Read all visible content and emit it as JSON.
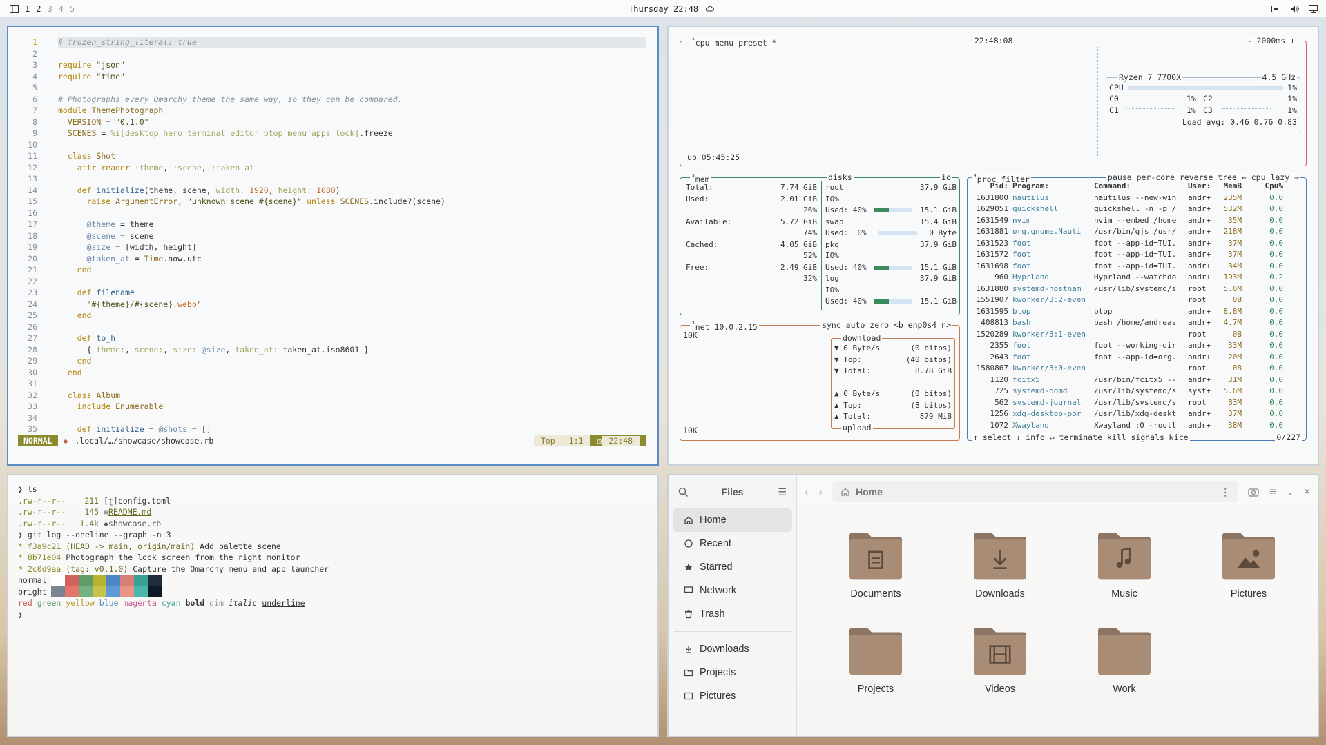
{
  "topbar": {
    "workspaces": [
      "1",
      "2",
      "3",
      "4",
      "5"
    ],
    "clock": "Thursday 22:48"
  },
  "editor": {
    "lines": [
      {
        "n": "1",
        "html": "<span class=\"c\"># frozen_string_literal: true</span>"
      },
      {
        "n": "2",
        "html": ""
      },
      {
        "n": "3",
        "html": "<span class=\"k\">require</span> <span class=\"s\">\"json\"</span>"
      },
      {
        "n": "4",
        "html": "<span class=\"k\">require</span> <span class=\"s\">\"time\"</span>"
      },
      {
        "n": "5",
        "html": ""
      },
      {
        "n": "6",
        "html": "<span class=\"c\"># Photographs every Omarchy theme the same way, so they can be compared.</span>"
      },
      {
        "n": "7",
        "html": "<span class=\"k\">module</span> <span class=\"cn\">ThemePhotograph</span>"
      },
      {
        "n": "8",
        "html": "  <span class=\"cn\">VERSION</span> = <span class=\"s\">\"0.1.0\"</span>"
      },
      {
        "n": "9",
        "html": "  <span class=\"cn\">SCENES</span> = <span class=\"sym\">%i[desktop hero terminal editor btop menu apps lock]</span>.freeze"
      },
      {
        "n": "10",
        "html": ""
      },
      {
        "n": "11",
        "html": "  <span class=\"k\">class</span> <span class=\"cn\">Shot</span>"
      },
      {
        "n": "12",
        "html": "    <span class=\"k\">attr_reader</span> <span class=\"sym\">:theme</span>, <span class=\"sym\">:scene</span>, <span class=\"sym\">:taken_at</span>"
      },
      {
        "n": "13",
        "html": ""
      },
      {
        "n": "14",
        "html": "    <span class=\"k\">def</span> <span class=\"fn\">initialize</span>(theme, scene, <span class=\"sym\">width:</span> <span class=\"nm\">1920</span>, <span class=\"sym\">height:</span> <span class=\"nm\">1080</span>)"
      },
      {
        "n": "15",
        "html": "      <span class=\"k\">raise</span> <span class=\"cn\">ArgumentError</span>, <span class=\"s\">\"unknown scene #{scene}\"</span> <span class=\"k\">unless</span> <span class=\"cn\">SCENES</span>.include?(scene)"
      },
      {
        "n": "16",
        "html": ""
      },
      {
        "n": "17",
        "html": "      <span class=\"iv\">@theme</span> = theme"
      },
      {
        "n": "18",
        "html": "      <span class=\"iv\">@scene</span> = scene"
      },
      {
        "n": "19",
        "html": "      <span class=\"iv\">@size</span> = [width, height]"
      },
      {
        "n": "20",
        "html": "      <span class=\"iv\">@taken_at</span> = <span class=\"cn\">Time</span>.now.utc"
      },
      {
        "n": "21",
        "html": "    <span class=\"k\">end</span>"
      },
      {
        "n": "22",
        "html": ""
      },
      {
        "n": "23",
        "html": "    <span class=\"k\">def</span> <span class=\"fn\">filename</span>"
      },
      {
        "n": "24",
        "html": "      <span class=\"s\">\"#{theme}/#{scene}<span class=\"nm\">.webp</span>\"</span>"
      },
      {
        "n": "25",
        "html": "    <span class=\"k\">end</span>"
      },
      {
        "n": "26",
        "html": ""
      },
      {
        "n": "27",
        "html": "    <span class=\"k\">def</span> <span class=\"fn\">to_h</span>"
      },
      {
        "n": "28",
        "html": "      { <span class=\"sym\">theme:</span>, <span class=\"sym\">scene:</span>, <span class=\"sym\">size:</span> <span class=\"iv\">@size</span>, <span class=\"sym\">taken_at:</span> taken_at.iso8601 }"
      },
      {
        "n": "29",
        "html": "    <span class=\"k\">end</span>"
      },
      {
        "n": "30",
        "html": "  <span class=\"k\">end</span>"
      },
      {
        "n": "31",
        "html": ""
      },
      {
        "n": "32",
        "html": "  <span class=\"k\">class</span> <span class=\"cn\">Album</span>"
      },
      {
        "n": "33",
        "html": "    <span class=\"k\">include</span> <span class=\"cn\">Enumerable</span>"
      },
      {
        "n": "34",
        "html": ""
      },
      {
        "n": "35",
        "html": "    <span class=\"k\">def</span> <span class=\"fn\">initialize</span> = <span class=\"iv\">@shots</span> = []"
      }
    ],
    "mode": "NORMAL",
    "path": ".local/…/showcase/showcase.rb",
    "pos_top": "Top",
    "pos_line": "1:1",
    "pos_time": "22:48"
  },
  "btop": {
    "cpu_tab": "cpu",
    "menu_tab": "menu",
    "preset_tab": "preset *",
    "clock": "22:48:08",
    "interval": "- 2000ms +",
    "cpu_model": "Ryzen 7 7700X",
    "cpu_freq": "4.5 GHz",
    "cpu_total_label": "CPU",
    "cpu_total_pct": "1%",
    "cores": [
      {
        "a": "C0",
        "ap": "1%",
        "b": "C2",
        "bp": "1%"
      },
      {
        "a": "C1",
        "ap": "1%",
        "b": "C3",
        "bp": "1%"
      }
    ],
    "load_avg": "Load avg: 0.46 0.76 0.83",
    "uptime": "up 05:45:25",
    "mem_title": "mem",
    "disks_title": "disks",
    "io_title": "io",
    "mem_rows": [
      {
        "l": "Total:",
        "v": "7.74 GiB"
      },
      {
        "l": "Used:",
        "v": "2.01 GiB"
      },
      {
        "l": "",
        "v": "26%"
      },
      {
        "l": "Available:",
        "v": "5.72 GiB"
      },
      {
        "l": "",
        "v": "74%"
      },
      {
        "l": "Cached:",
        "v": "4.05 GiB"
      },
      {
        "l": "",
        "v": "52%"
      },
      {
        "l": "Free:",
        "v": "2.49 GiB"
      },
      {
        "l": "",
        "v": "32%"
      }
    ],
    "disk_rows": [
      {
        "l": "root",
        "v": "37.9 GiB"
      },
      {
        "l": "IO%",
        "v": ""
      },
      {
        "l": "Used: 40%",
        "v": "15.1 GiB",
        "bar": 0.4
      },
      {
        "l": "swap",
        "v": "15.4 GiB"
      },
      {
        "l": "Used:  0%",
        "v": "0 Byte",
        "bar": 0.0
      },
      {
        "l": "pkg",
        "v": "37.9 GiB"
      },
      {
        "l": "IO%",
        "v": ""
      },
      {
        "l": "Used: 40%",
        "v": "15.1 GiB",
        "bar": 0.4
      },
      {
        "l": "log",
        "v": "37.9 GiB"
      },
      {
        "l": "IO%",
        "v": ""
      },
      {
        "l": "Used: 40%",
        "v": "15.1 GiB",
        "bar": 0.4
      }
    ],
    "net_title": "net",
    "net_ip": "10.0.2.15",
    "net_opts": "sync auto zero <b enp0s4 n>",
    "net_scale_top": "10K",
    "net_scale_bottom": "10K",
    "download_label": "download",
    "upload_label": "upload",
    "down_rows": [
      {
        "l": "▼ 0 Byte/s",
        "v": "(0 bitps)"
      },
      {
        "l": "▼ Top:",
        "v": "(40 bitps)"
      },
      {
        "l": "▼ Total:",
        "v": "8.78 GiB"
      }
    ],
    "up_rows": [
      {
        "l": "▲ 0 Byte/s",
        "v": "(0 bitps)"
      },
      {
        "l": "▲ Top:",
        "v": "(8 bitps)"
      },
      {
        "l": "▲ Total:",
        "v": "879 MiB"
      }
    ],
    "proc_title": "proc",
    "proc_filter": "filter",
    "proc_opts": "pause per-core reverse tree ← cpu lazy →",
    "proc_header": {
      "pid": "Pid:",
      "prog": "Program:",
      "cmd": "Command:",
      "user": "User:",
      "mem": "MemB",
      "cpu": "Cpu%"
    },
    "procs": [
      {
        "pid": "1631800",
        "prog": "nautilus",
        "cmd": "nautilus --new-win",
        "user": "andr+",
        "mem": "235M",
        "cpu": "0.0"
      },
      {
        "pid": "1629051",
        "prog": "quickshell",
        "cmd": "quickshell -n -p /",
        "user": "andr+",
        "mem": "532M",
        "cpu": "0.0"
      },
      {
        "pid": "1631549",
        "prog": "nvim",
        "cmd": "nvim --embed /home",
        "user": "andr+",
        "mem": "35M",
        "cpu": "0.0"
      },
      {
        "pid": "1631881",
        "prog": "org.gnome.Nauti",
        "cmd": "/usr/bin/gjs /usr/",
        "user": "andr+",
        "mem": "218M",
        "cpu": "0.0"
      },
      {
        "pid": "1631523",
        "prog": "foot",
        "cmd": "foot --app-id=TUI.",
        "user": "andr+",
        "mem": "37M",
        "cpu": "0.0"
      },
      {
        "pid": "1631572",
        "prog": "foot",
        "cmd": "foot --app-id=TUI.",
        "user": "andr+",
        "mem": "37M",
        "cpu": "0.0"
      },
      {
        "pid": "1631698",
        "prog": "foot",
        "cmd": "foot --app-id=TUI.",
        "user": "andr+",
        "mem": "34M",
        "cpu": "0.0"
      },
      {
        "pid": "960",
        "prog": "Hyprland",
        "cmd": "Hyprland --watchdo",
        "user": "andr+",
        "mem": "193M",
        "cpu": "0.2"
      },
      {
        "pid": "1631880",
        "prog": "systemd-hostnam",
        "cmd": "/usr/lib/systemd/s",
        "user": "root",
        "mem": "5.6M",
        "cpu": "0.0"
      },
      {
        "pid": "1551907",
        "prog": "kworker/3:2-even",
        "cmd": "",
        "user": "root",
        "mem": "0B",
        "cpu": "0.0"
      },
      {
        "pid": "1631595",
        "prog": "btop",
        "cmd": "btop",
        "user": "andr+",
        "mem": "8.8M",
        "cpu": "0.0"
      },
      {
        "pid": "408813",
        "prog": "bash",
        "cmd": "bash /home/andreas",
        "user": "andr+",
        "mem": "4.7M",
        "cpu": "0.0"
      },
      {
        "pid": "1520289",
        "prog": "kworker/3:1-even",
        "cmd": "",
        "user": "root",
        "mem": "0B",
        "cpu": "0.0"
      },
      {
        "pid": "2355",
        "prog": "foot",
        "cmd": "foot --working-dir",
        "user": "andr+",
        "mem": "33M",
        "cpu": "0.0"
      },
      {
        "pid": "2643",
        "prog": "foot",
        "cmd": "foot --app-id=org.",
        "user": "andr+",
        "mem": "20M",
        "cpu": "0.0"
      },
      {
        "pid": "1580867",
        "prog": "kworker/3:0-even",
        "cmd": "",
        "user": "root",
        "mem": "0B",
        "cpu": "0.0"
      },
      {
        "pid": "1120",
        "prog": "fcitx5",
        "cmd": "/usr/bin/fcitx5 --",
        "user": "andr+",
        "mem": "31M",
        "cpu": "0.0"
      },
      {
        "pid": "725",
        "prog": "systemd-oomd",
        "cmd": "/usr/lib/systemd/s",
        "user": "syst+",
        "mem": "5.6M",
        "cpu": "0.0"
      },
      {
        "pid": "562",
        "prog": "systemd-journal",
        "cmd": "/usr/lib/systemd/s",
        "user": "root",
        "mem": "83M",
        "cpu": "0.0"
      },
      {
        "pid": "1256",
        "prog": "xdg-desktop-por",
        "cmd": "/usr/lib/xdg-deskt",
        "user": "andr+",
        "mem": "37M",
        "cpu": "0.0"
      },
      {
        "pid": "1072",
        "prog": "Xwayland",
        "cmd": "Xwayland :0 -rootl",
        "user": "andr+",
        "mem": "38M",
        "cpu": "0.0"
      }
    ],
    "proc_footer": "↑ select ↓ info ↵ terminate kill signals Nice",
    "proc_count": "0/227"
  },
  "terminal": {
    "prompt": "❯",
    "cmd1": "ls",
    "files": [
      {
        "perm": ".rw-r--r--",
        "size": "211",
        "icon": "[ʈ]",
        "name": "config.toml"
      },
      {
        "perm": ".rw-r--r--",
        "size": "145",
        "icon": "▤",
        "name": "README.md"
      },
      {
        "perm": ".rw-r--r--",
        "size": "1.4k",
        "icon": "◆",
        "name": "showcase.rb"
      }
    ],
    "cmd2": "git log --oneline --graph -n 3",
    "commits": [
      {
        "hash": "f3a9c21",
        "refs": "(HEAD -> main, origin/main)",
        "msg": "Add palette scene"
      },
      {
        "hash": "8b71e04",
        "refs": "",
        "msg": "Photograph the lock screen from the right monitor"
      },
      {
        "hash": "2c0d9aa",
        "refs": "(tag: v0.1.0)",
        "msg": "Capture the Omarchy menu and app launcher"
      }
    ],
    "normal_label": "normal",
    "bright_label": "bright",
    "palette_normal": [
      "#ffffff",
      "#d3625c",
      "#5e9c6a",
      "#b9b32e",
      "#4d86c6",
      "#d77f74",
      "#3aa196",
      "#1f2d3a"
    ],
    "palette_bright": [
      "#7a8592",
      "#e4756c",
      "#75b27f",
      "#c8c14a",
      "#5d9bd8",
      "#e89586",
      "#4bb7aa",
      "#0d1b26"
    ],
    "styles": [
      "red",
      "green",
      "yellow",
      "blue",
      "magenta",
      "cyan",
      "bold",
      "dim",
      "italic",
      "underline"
    ]
  },
  "files": {
    "title": "Files",
    "sidebar": [
      {
        "icon": "home-icon",
        "label": "Home"
      },
      {
        "icon": "recent-icon",
        "label": "Recent"
      },
      {
        "icon": "star-icon",
        "label": "Starred"
      },
      {
        "icon": "network-icon",
        "label": "Network"
      },
      {
        "icon": "trash-icon",
        "label": "Trash"
      }
    ],
    "bookmarks": [
      {
        "icon": "download-icon",
        "label": "Downloads"
      },
      {
        "icon": "folder-icon",
        "label": "Projects"
      },
      {
        "icon": "pictures-icon",
        "label": "Pictures"
      }
    ],
    "location": "Home",
    "folders": [
      {
        "label": "Documents",
        "glyph": "document-icon"
      },
      {
        "label": "Downloads",
        "glyph": "download-icon"
      },
      {
        "label": "Music",
        "glyph": "music-icon"
      },
      {
        "label": "Pictures",
        "glyph": "pictures-icon"
      },
      {
        "label": "Projects",
        "glyph": ""
      },
      {
        "label": "Videos",
        "glyph": "film-icon"
      },
      {
        "label": "Work",
        "glyph": ""
      }
    ]
  }
}
